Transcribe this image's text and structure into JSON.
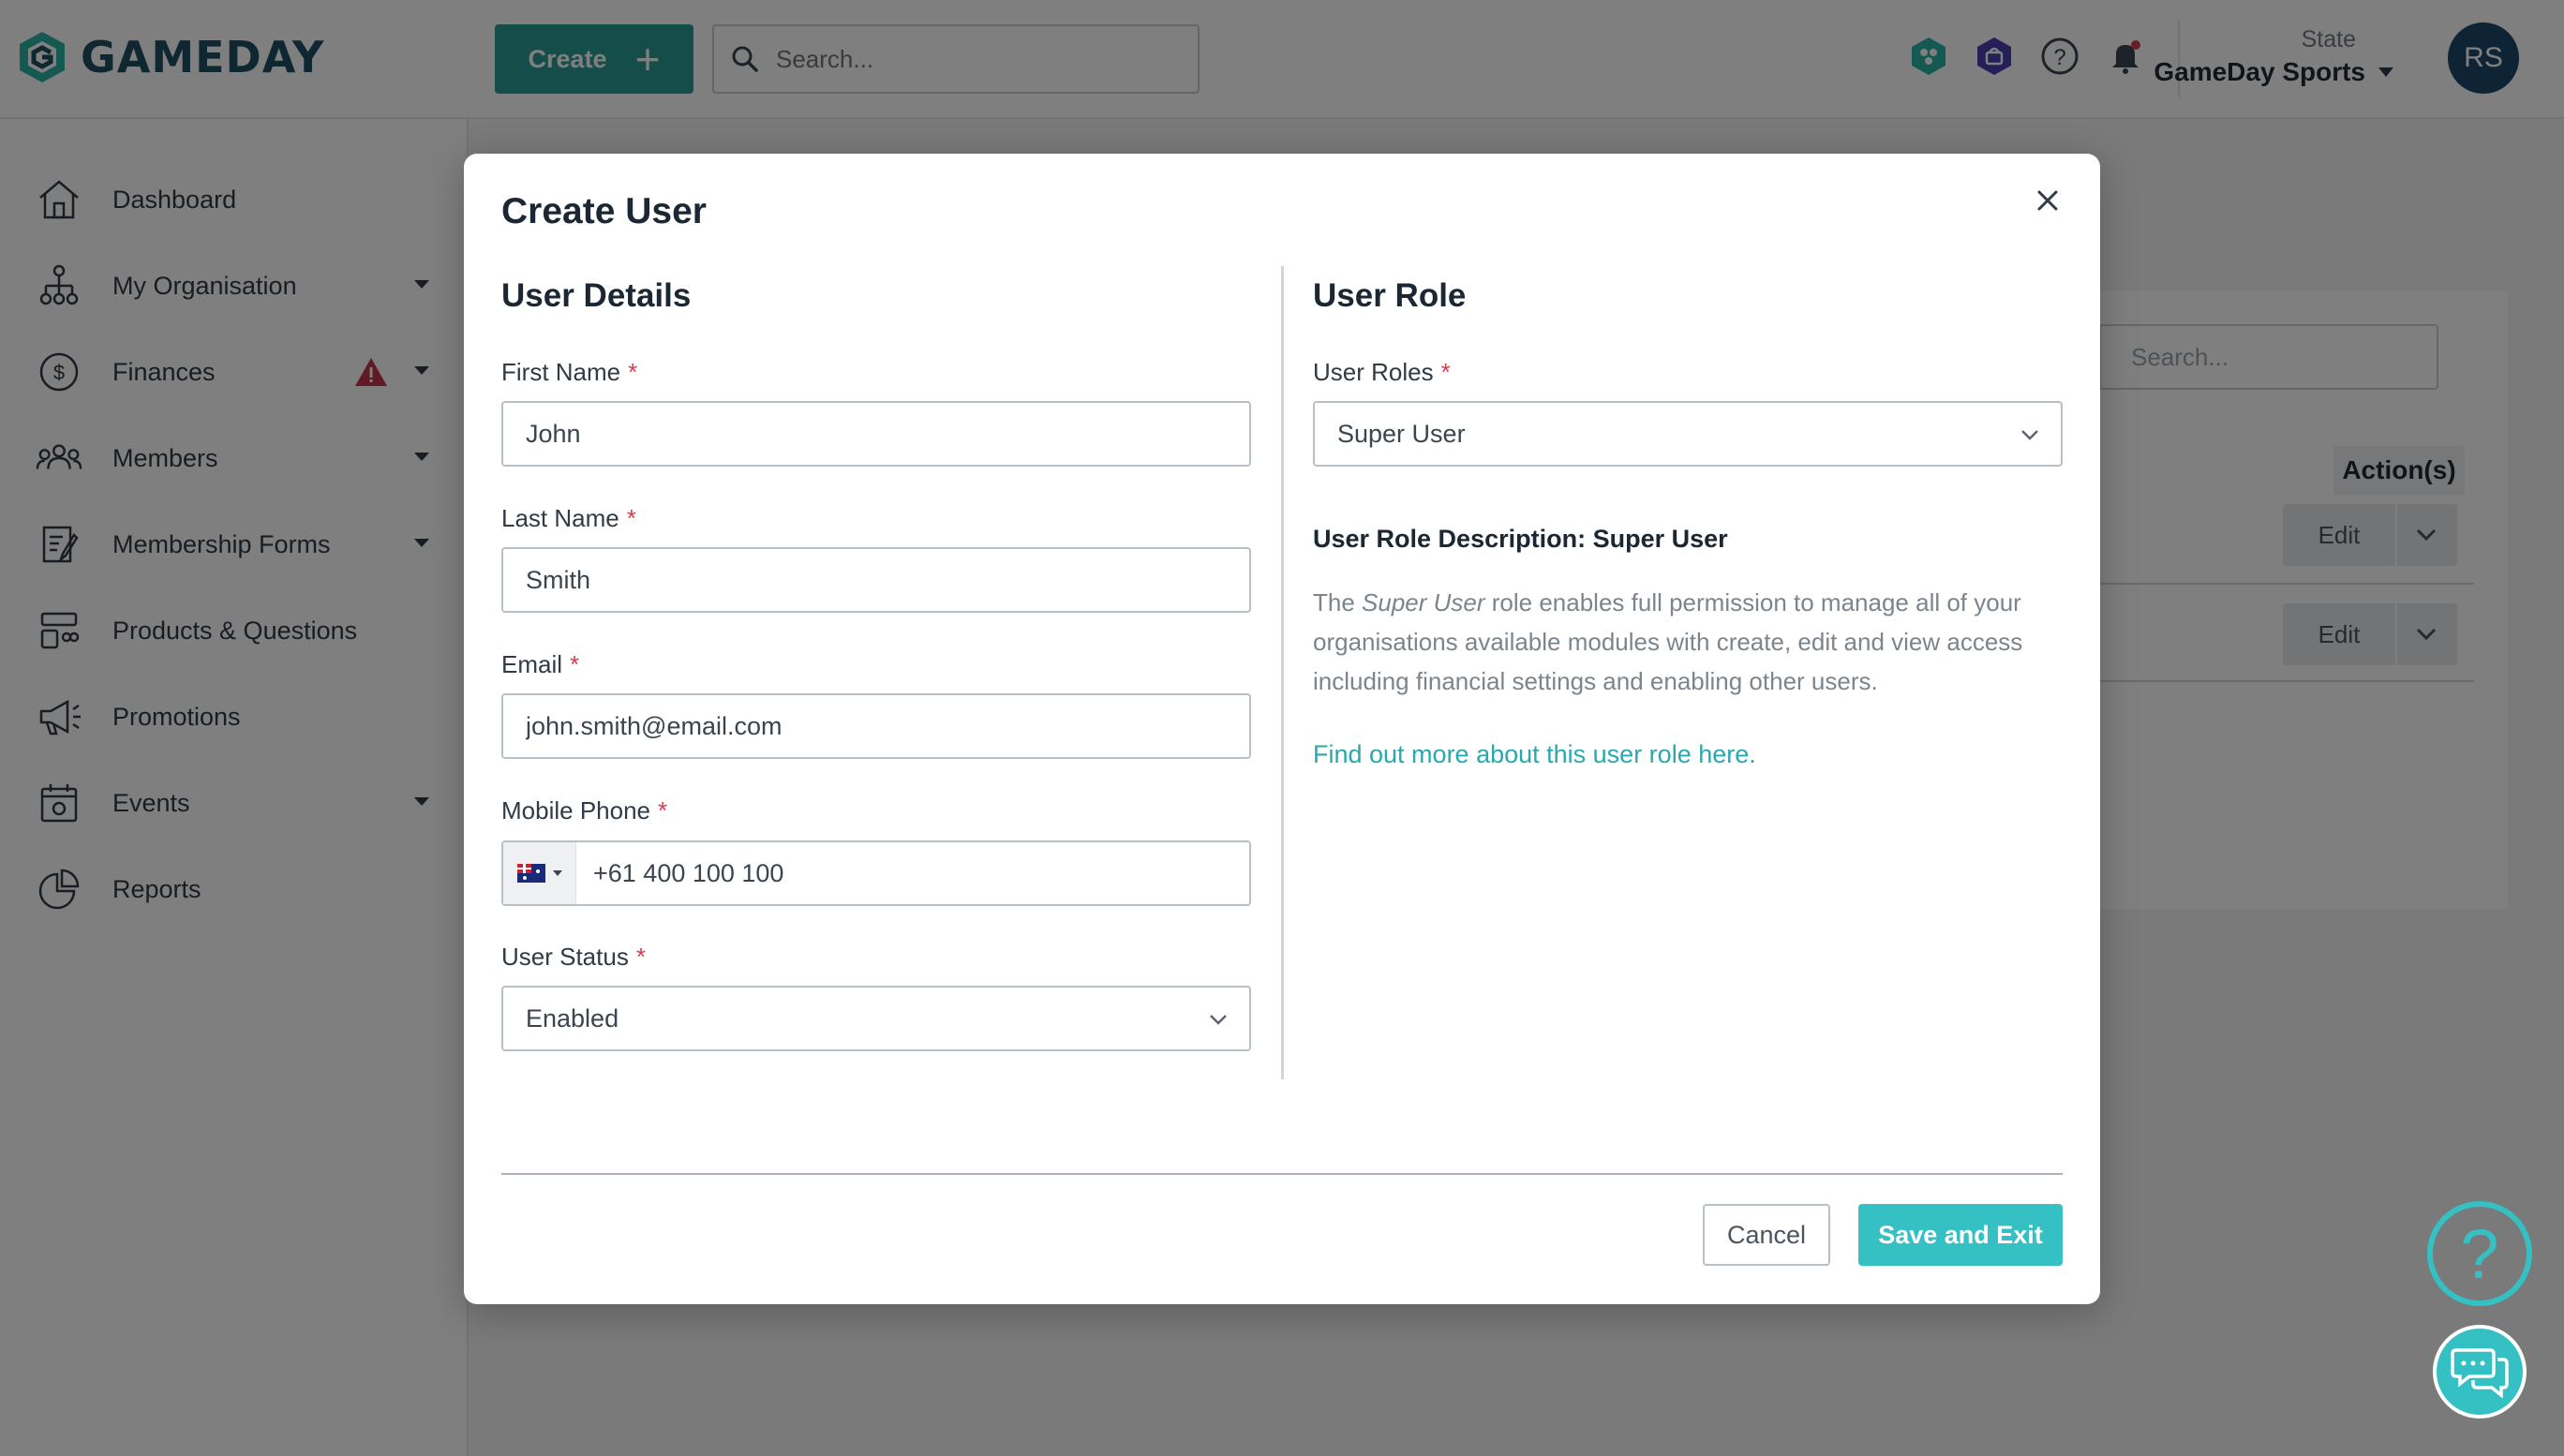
{
  "app": {
    "logo_text": "GAMEDAY",
    "create_label": "Create",
    "search_placeholder": "Search...",
    "org_state": "State",
    "org_name": "GameDay Sports",
    "avatar_initials": "RS"
  },
  "sidebar": {
    "items": [
      {
        "label": "Dashboard",
        "icon": "home-icon"
      },
      {
        "label": "My Organisation",
        "icon": "org-chart-icon"
      },
      {
        "label": "Finances",
        "icon": "dollar-icon"
      },
      {
        "label": "Members",
        "icon": "members-icon"
      },
      {
        "label": "Membership Forms",
        "icon": "form-icon"
      },
      {
        "label": "Products & Questions",
        "icon": "products-icon"
      },
      {
        "label": "Promotions",
        "icon": "megaphone-icon"
      },
      {
        "label": "Events",
        "icon": "calendar-icon"
      },
      {
        "label": "Reports",
        "icon": "pie-chart-icon"
      }
    ]
  },
  "background": {
    "search_placeholder": "Search...",
    "actions_header": "Action(s)",
    "edit_label": "Edit"
  },
  "modal": {
    "title": "Create User",
    "details": {
      "heading": "User Details",
      "first_name_label": "First Name",
      "first_name_value": "John",
      "last_name_label": "Last Name",
      "last_name_value": "Smith",
      "email_label": "Email",
      "email_value": "john.smith@email.com",
      "phone_label": "Mobile Phone",
      "phone_value": "+61 400 100 100",
      "status_label": "User Status",
      "status_value": "Enabled",
      "required_mark": "*"
    },
    "role": {
      "heading": "User Role",
      "roles_label": "User Roles",
      "roles_value": "Super User",
      "description_title": "User Role Description: Super User",
      "description_prefix": "The ",
      "description_role": "Super User",
      "description_suffix": " role enables full permission to manage all of your organisations available modules with create, edit and view access including financial settings and enabling other users.",
      "link_text": "Find out more about this user role here."
    },
    "cancel_label": "Cancel",
    "save_label": "Save and Exit"
  },
  "help_fab_label": "?",
  "colors": {
    "accent": "#35c0c4",
    "create_button": "#2b9a94",
    "required": "#d63c4e",
    "avatar": "#1d4766"
  }
}
